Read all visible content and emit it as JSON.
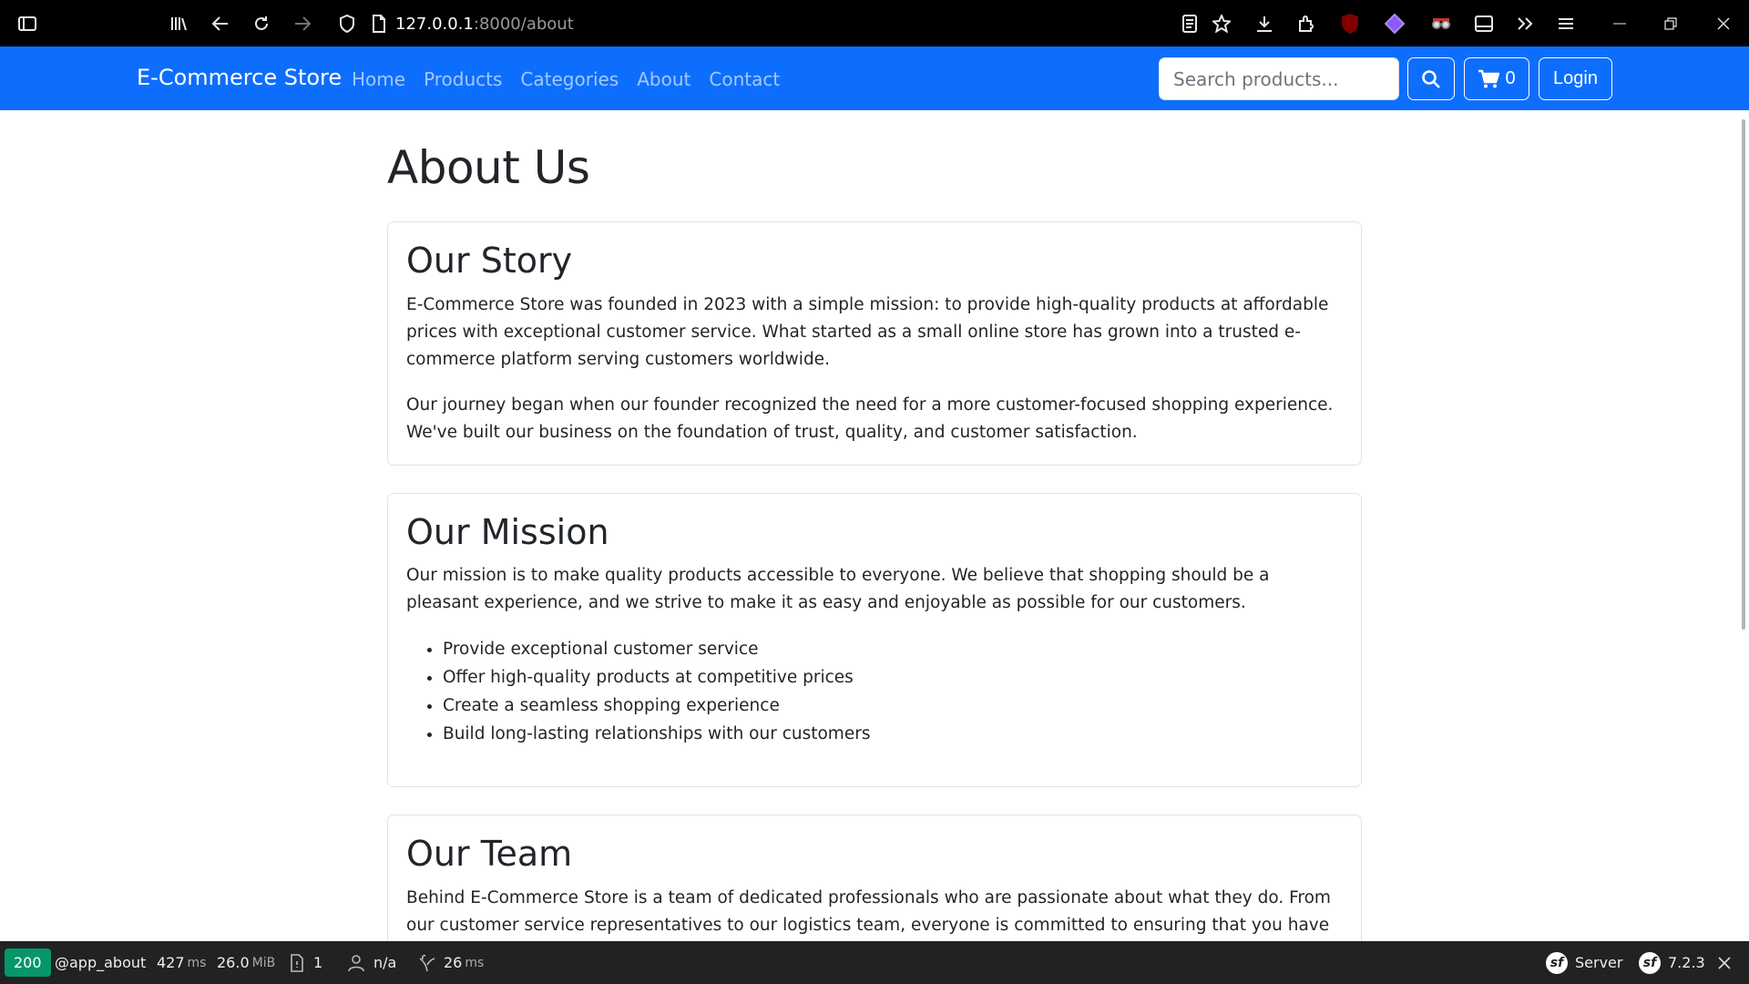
{
  "browser": {
    "url_host": "127.0.0.1",
    "url_path": ":8000/about"
  },
  "navbar": {
    "brand": "E-Commerce Store",
    "links": [
      "Home",
      "Products",
      "Categories",
      "About",
      "Contact"
    ],
    "search_placeholder": "Search products...",
    "cart_count": "0",
    "login_label": "Login"
  },
  "page": {
    "title": "About Us",
    "story": {
      "heading": "Our Story",
      "p1": "E-Commerce Store was founded in 2023 with a simple mission: to provide high-quality products at affordable prices with exceptional customer service. What started as a small online store has grown into a trusted e-commerce platform serving customers worldwide.",
      "p2": "Our journey began when our founder recognized the need for a more customer-focused shopping experience. We've built our business on the foundation of trust, quality, and customer satisfaction."
    },
    "mission": {
      "heading": "Our Mission",
      "p1": "Our mission is to make quality products accessible to everyone. We believe that shopping should be a pleasant experience, and we strive to make it as easy and enjoyable as possible for our customers.",
      "items": [
        "Provide exceptional customer service",
        "Offer high-quality products at competitive prices",
        "Create a seamless shopping experience",
        "Build long-lasting relationships with our customers"
      ]
    },
    "team": {
      "heading": "Our Team",
      "p1": "Behind E-Commerce Store is a team of dedicated professionals who are passionate about what they do. From our customer service representatives to our logistics team, everyone is committed to ensuring that you have the best"
    }
  },
  "debug_toolbar": {
    "status": "200",
    "route": "@app_about",
    "time_value": "427",
    "time_unit": "ms",
    "memory_value": "26.0",
    "memory_unit": "MiB",
    "logs_count": "1",
    "user": "n/a",
    "twig_value": "26",
    "twig_unit": "ms",
    "server_label": "Server",
    "symfony_version": "7.2.3"
  },
  "colors": {
    "navbar": "#0d6efd",
    "status_ok": "#059669"
  }
}
